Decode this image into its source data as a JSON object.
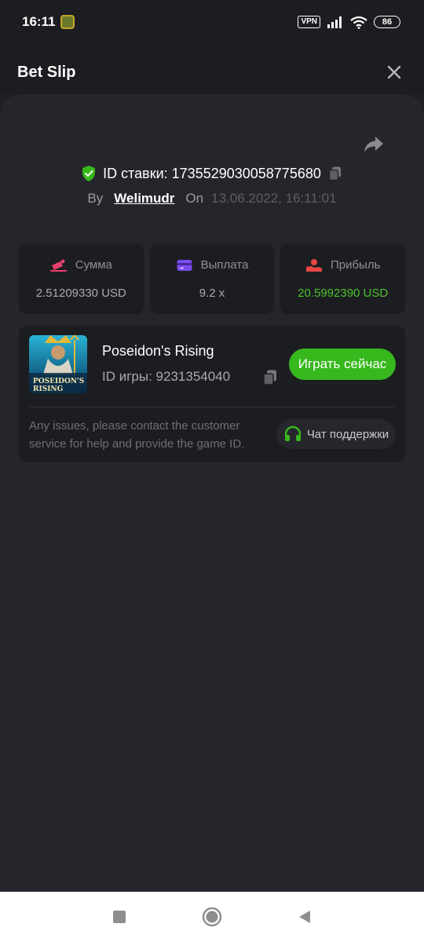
{
  "status_bar": {
    "time": "16:11",
    "vpn": "VPN",
    "battery": "86"
  },
  "header": {
    "title": "Bet Slip",
    "close_icon": "close-icon"
  },
  "bet": {
    "id_text": "ID ставки: 1735529030058775680",
    "by_label": "By",
    "username": "Welimudr",
    "on_label": "On",
    "datetime": "13.06.2022, 16:11:01"
  },
  "stats": [
    {
      "label": "Сумма",
      "value": "2.51209330 USD",
      "icon": "bet-amount-icon",
      "color": "#e8406c"
    },
    {
      "label": "Выплата",
      "value": "9.2 x",
      "icon": "card-icon",
      "color": "#7b4cf0"
    },
    {
      "label": "Прибыль",
      "value": "20.5992390 USD",
      "icon": "profit-icon",
      "color": "#e84545"
    }
  ],
  "game": {
    "name": "Poseidon's Rising",
    "id_text": "ID игры: 9231354040",
    "thumb_text": "POSEIDON'S RISING",
    "play_label": "Играть сейчас",
    "support_text": "Any issues, please contact the customer service for help and provide the game ID.",
    "support_label": "Чат поддержки"
  },
  "colors": {
    "accent_green": "#37b81d",
    "profit_green": "#4dc42d",
    "background": "#1f2024"
  }
}
